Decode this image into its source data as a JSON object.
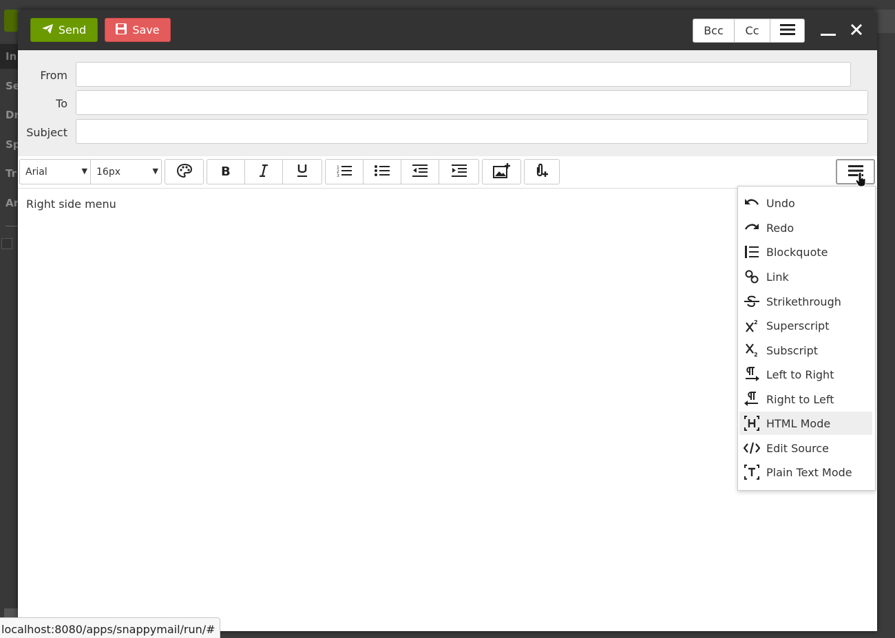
{
  "header": {
    "send_label": "Send",
    "save_label": "Save",
    "bcc_label": "Bcc",
    "cc_label": "Cc"
  },
  "fields": {
    "from_label": "From",
    "to_label": "To",
    "subject_label": "Subject",
    "from_value": "",
    "to_value": "",
    "subject_value": ""
  },
  "toolbar": {
    "font_family": "Arial",
    "font_size": "16px"
  },
  "editor": {
    "content": "Right side menu"
  },
  "dropdown": {
    "items": [
      {
        "label": "Undo",
        "icon": "undo-icon"
      },
      {
        "label": "Redo",
        "icon": "redo-icon"
      },
      {
        "label": "Blockquote",
        "icon": "blockquote-icon"
      },
      {
        "label": "Link",
        "icon": "link-icon"
      },
      {
        "label": "Strikethrough",
        "icon": "strikethrough-icon"
      },
      {
        "label": "Superscript",
        "icon": "superscript-icon"
      },
      {
        "label": "Subscript",
        "icon": "subscript-icon"
      },
      {
        "label": "Left to Right",
        "icon": "ltr-icon"
      },
      {
        "label": "Right to Left",
        "icon": "rtl-icon"
      },
      {
        "label": "HTML Mode",
        "icon": "html-mode-icon"
      },
      {
        "label": "Edit Source",
        "icon": "code-icon"
      },
      {
        "label": "Plain Text Mode",
        "icon": "plain-text-icon"
      }
    ],
    "highlighted": "HTML Mode"
  },
  "statusbar": {
    "url": "localhost:8080/apps/snappymail/run/#"
  },
  "background": {
    "sidebar_items": [
      "In",
      "Se",
      "Dr",
      "Sp",
      "Tr",
      "Ar"
    ]
  },
  "colors": {
    "send": "#6b9a00",
    "save": "#e45b5b",
    "header": "#333333",
    "highlight": "#eeeeee"
  }
}
